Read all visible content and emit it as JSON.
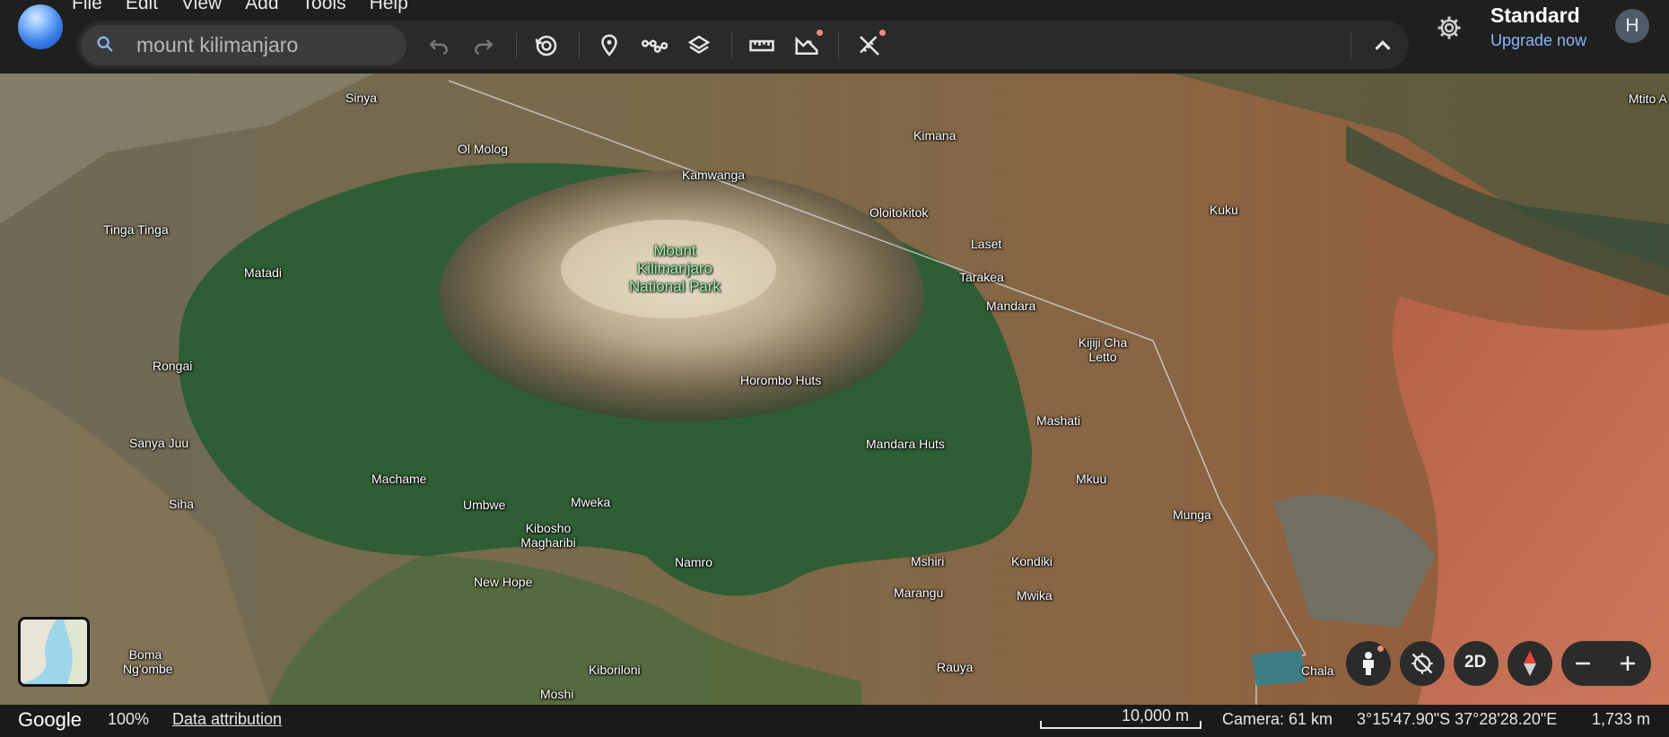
{
  "app": {
    "menu": [
      "File",
      "Edit",
      "View",
      "Add",
      "Tools",
      "Help"
    ]
  },
  "search": {
    "value": "mount kilimanjaro",
    "placeholder": ""
  },
  "toolbar": {
    "icons": [
      "undo-icon",
      "redo-icon",
      "historical-imagery-icon",
      "placemark-icon",
      "path-icon",
      "layers-icon",
      "ruler-icon",
      "projects-icon",
      "measure-icon",
      "collapse-chevron-icon"
    ]
  },
  "account": {
    "plan": "Standard",
    "upgrade": "Upgrade now",
    "avatar_initial": "H"
  },
  "map": {
    "park_name": "Mount Kilimanjaro National Park",
    "park_lines": [
      "Mount",
      "Kilimanjaro",
      "National Park"
    ],
    "places": [
      "Sinya",
      "Ol Molog",
      "Kimana",
      "Kamwanga",
      "Oloitokitok",
      "Kuku",
      "Mtito A",
      "Tinga Tinga",
      "Matadi",
      "Laset",
      "Tarakea",
      "Mandara",
      "Kijiji Cha Letto",
      "Rongai",
      "Horombo Huts",
      "Mashati",
      "Sanya Juu",
      "Mandara Huts",
      "Machame",
      "Mkuu",
      "Siha",
      "Umbwe",
      "Mweka",
      "Munga",
      "Kibosho Magharibi",
      "Namro",
      "Mshiri",
      "Kondiki",
      "New Hope",
      "Marangu",
      "Mwika",
      "Boma Ng'ombe",
      "Kiboriloni",
      "Rauya",
      "Chala",
      "Moshi"
    ]
  },
  "controls": {
    "view_mode": "2D",
    "icons": [
      "street-view-icon",
      "lock-orientation-icon",
      "compass-icon",
      "zoom-out-icon",
      "zoom-in-icon"
    ]
  },
  "status": {
    "brand": "Google",
    "zoom": "100%",
    "attribution": "Data attribution",
    "scale": "10,000 m",
    "camera": "Camera: 61 km",
    "coordinates": "3°15'47.90\"S 37°28'28.20\"E",
    "elevation": "1,733 m"
  },
  "colors": {
    "accent": "#8ab4f8",
    "notification": "#f28b82",
    "park_label": "#a6ecb1"
  }
}
